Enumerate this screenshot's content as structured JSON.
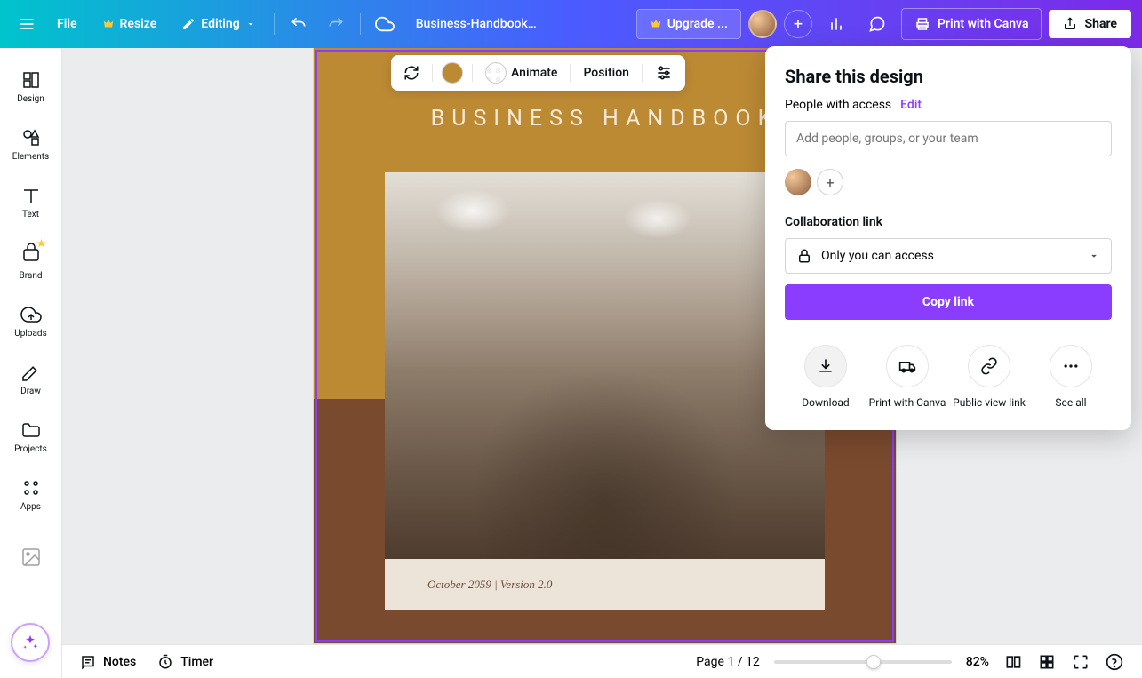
{
  "topbar": {
    "file": "File",
    "resize": "Resize",
    "editing": "Editing",
    "doc_title": "Business-Handbook-...",
    "upgrade": "Upgrade ...",
    "print": "Print with Canva",
    "share": "Share"
  },
  "sidebar": {
    "items": [
      {
        "label": "Design"
      },
      {
        "label": "Elements"
      },
      {
        "label": "Text"
      },
      {
        "label": "Brand"
      },
      {
        "label": "Uploads"
      },
      {
        "label": "Draw"
      },
      {
        "label": "Projects"
      },
      {
        "label": "Apps"
      }
    ]
  },
  "element_toolbar": {
    "animate": "Animate",
    "position": "Position",
    "color": "#bd8a34"
  },
  "canvas": {
    "page_title": "BUSINESS HANDBOOK",
    "caption": "October 2059 | Version 2.0"
  },
  "share_panel": {
    "title": "Share this design",
    "access_label": "People with access",
    "edit": "Edit",
    "input_placeholder": "Add people, groups, or your team",
    "collab_label": "Collaboration link",
    "select_value": "Only you can access",
    "copy_btn": "Copy link",
    "actions": [
      {
        "label": "Download"
      },
      {
        "label": "Print with Canva"
      },
      {
        "label": "Public view link"
      },
      {
        "label": "See all"
      }
    ]
  },
  "bottombar": {
    "notes": "Notes",
    "timer": "Timer",
    "page_info": "Page 1 / 12",
    "zoom": "82%"
  }
}
